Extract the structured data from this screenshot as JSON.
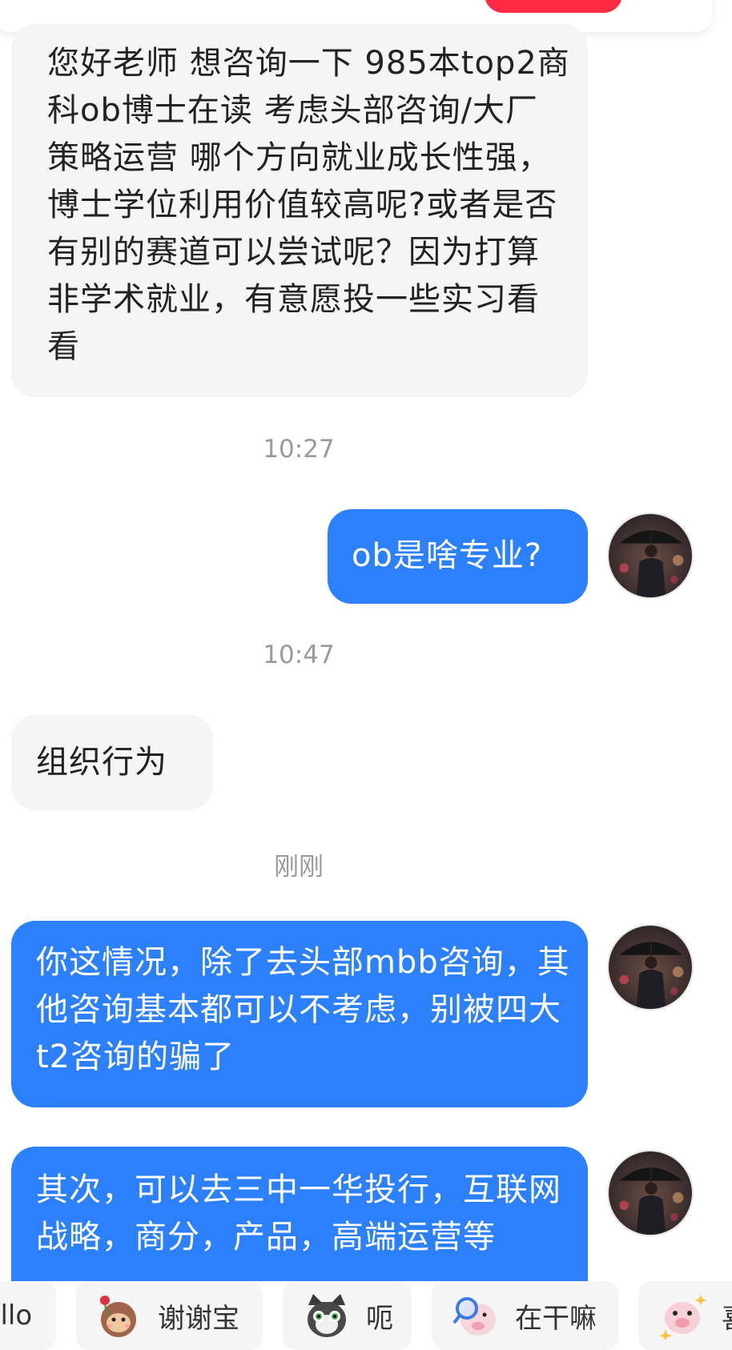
{
  "messages": [
    {
      "side": "received",
      "text": "您好老师 想咨询一下 985本top2商科ob博士在读 考虑头部咨询/大厂策略运营 哪个方向就业成长性强，博士学位利用价值较高呢?或者是否有别的赛道可以尝试呢？因为打算非学术就业，有意愿投一些实习看看"
    },
    {
      "type": "time",
      "text": "10:27"
    },
    {
      "side": "sent",
      "text": "ob是啥专业?"
    },
    {
      "type": "time",
      "text": "10:47"
    },
    {
      "side": "received",
      "text": "组织行为"
    },
    {
      "type": "time",
      "text": "刚刚"
    },
    {
      "side": "sent",
      "text": "你这情况，除了去头部mbb咨询，其他咨询基本都可以不考虑，别被四大t2咨询的骗了"
    },
    {
      "side": "sent",
      "text": "其次，可以去三中一华投行，互联网战略，商分，产品，高端运营等"
    }
  ],
  "quick_replies": [
    {
      "label": "hello",
      "icon": "waving-sticker-icon"
    },
    {
      "label": "谢谢宝",
      "icon": "monkey-rose-sticker-icon"
    },
    {
      "label": "呃",
      "icon": "cat-sticker-icon"
    },
    {
      "label": "在干嘛",
      "icon": "pig-magnifier-sticker-icon"
    },
    {
      "label": "喜",
      "icon": "pig-sparkle-sticker-icon"
    }
  ],
  "colors": {
    "sent_bubble": "#2c80fb",
    "received_bubble": "#f5f5f5",
    "timestamp": "#9a9a9a",
    "top_button": "#ff2b45"
  }
}
